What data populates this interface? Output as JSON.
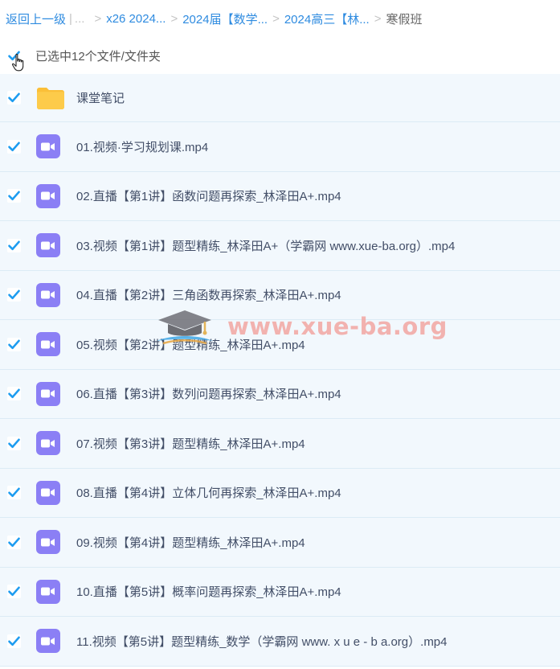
{
  "breadcrumb": {
    "back": "返回上一级",
    "pipe": "|",
    "dots": "...",
    "crumbs": [
      "x26 2024...",
      "2024届【数学...",
      "2024高三【林..."
    ],
    "current": "寒假班",
    "separator": ">"
  },
  "selection": {
    "label": "已选中12个文件/文件夹"
  },
  "files": [
    {
      "name": "课堂笔记",
      "type": "folder-icon"
    },
    {
      "name": "01.视频·学习规划课.mp4",
      "type": "video-icon"
    },
    {
      "name": "02.直播【第1讲】函数问题再探索_林泽田A+.mp4",
      "type": "video-icon"
    },
    {
      "name": "03.视频【第1讲】题型精练_林泽田A+（学霸网 www.xue-ba.org）.mp4",
      "type": "video-icon"
    },
    {
      "name": "04.直播【第2讲】三角函数再探索_林泽田A+.mp4",
      "type": "video-icon"
    },
    {
      "name": "05.视频【第2讲】题型精练_林泽田A+.mp4",
      "type": "video-icon"
    },
    {
      "name": "06.直播【第3讲】数列问题再探索_林泽田A+.mp4",
      "type": "video-icon"
    },
    {
      "name": "07.视频【第3讲】题型精练_林泽田A+.mp4",
      "type": "video-icon"
    },
    {
      "name": "08.直播【第4讲】立体几何再探索_林泽田A+.mp4",
      "type": "video-icon"
    },
    {
      "name": "09.视频【第4讲】题型精练_林泽田A+.mp4",
      "type": "video-icon"
    },
    {
      "name": "10.直播【第5讲】概率问题再探索_林泽田A+.mp4",
      "type": "video-icon"
    },
    {
      "name": "11.视频【第5讲】题型精练_数学（学霸网 www. x u e - b a.org）.mp4",
      "type": "video-icon"
    }
  ],
  "watermark": {
    "text": "www.xue-ba.org"
  },
  "colors": {
    "link": "#2e8be0",
    "checkbox": "#1d9cf0",
    "row_bg": "#f2f8fd",
    "row_border": "#dcebf5",
    "video_icon": "#8b7ff5",
    "folder": "#fdc643"
  }
}
